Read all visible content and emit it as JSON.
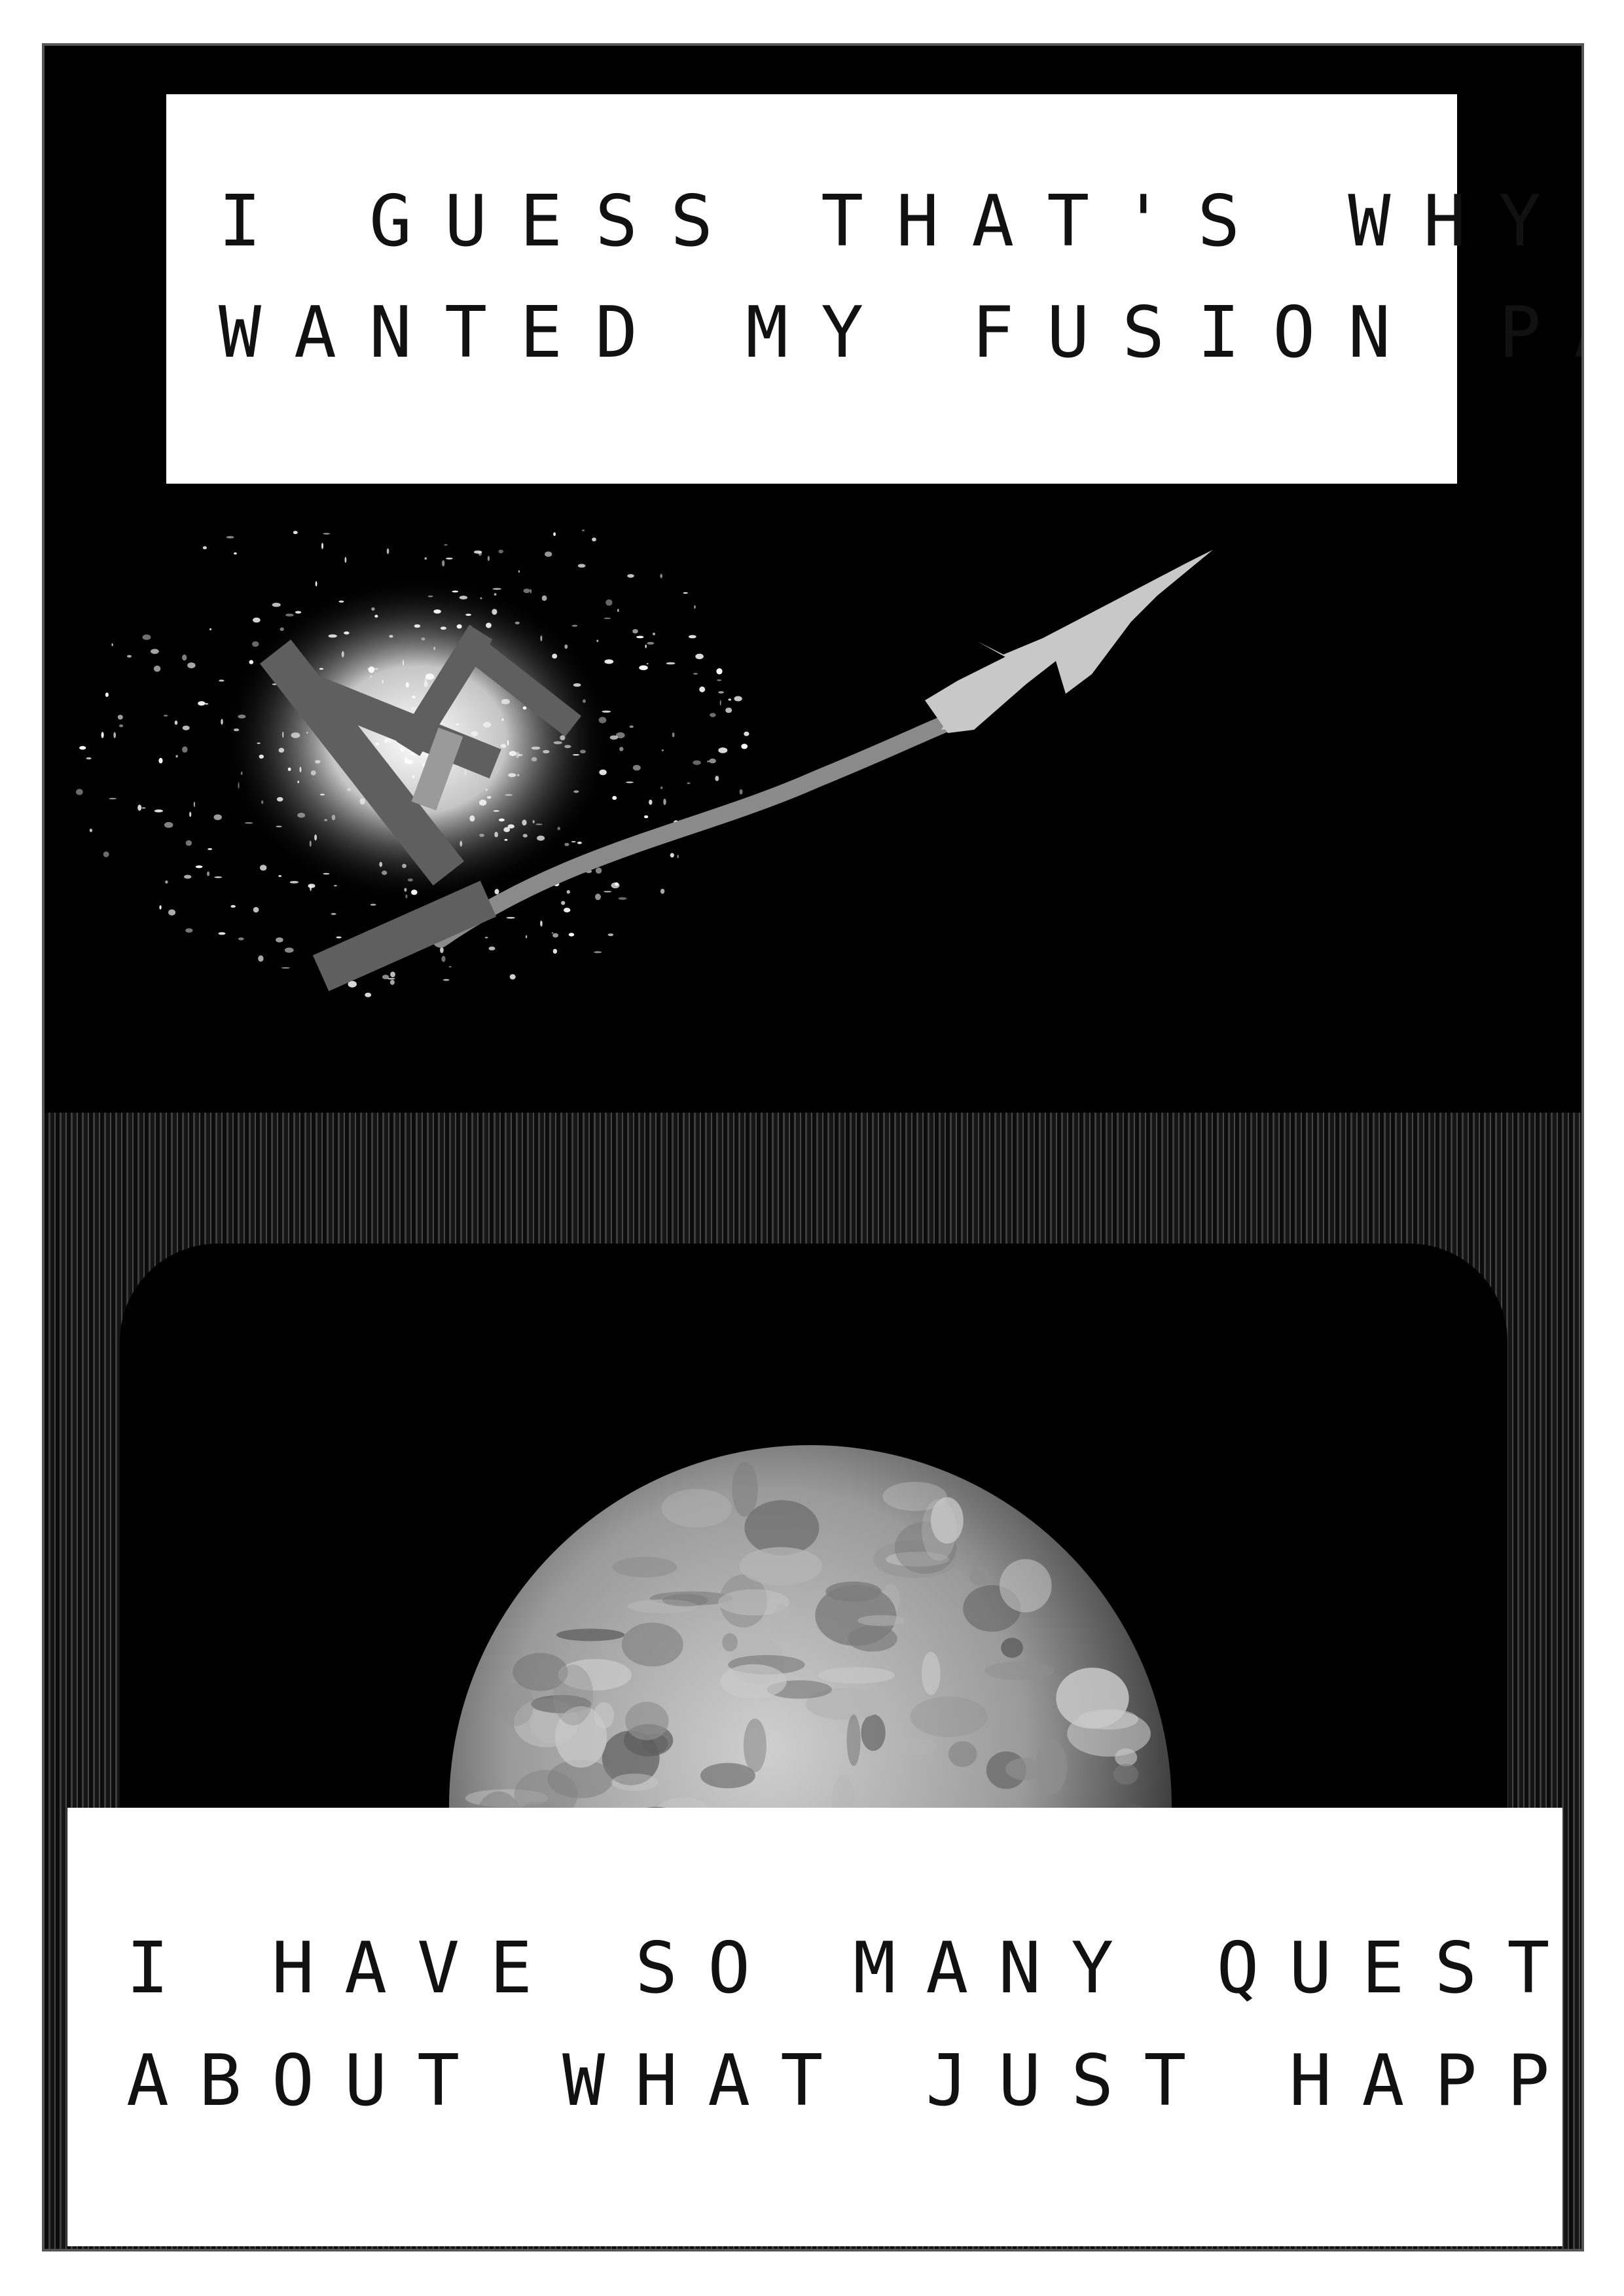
{
  "panels": {
    "top": {
      "caption_lines": [
        "I guess that's why he",
        "wanted my fusion pack.."
      ]
    },
    "bottom": {
      "caption_lines": [
        "I have so many questions",
        "about what just happened.."
      ]
    }
  },
  "colors": {
    "background": "#000000",
    "caption_box": "#ffffff",
    "station": "#6a6a6a",
    "ship": "#c8c8c8",
    "trail": "#8a8a8a",
    "moon_light": "#d9d9d9",
    "moon_dark": "#5a5a5a"
  },
  "icons": {
    "station": "space-station-icon",
    "ship": "spaceship-icon",
    "moon": "moon-icon"
  }
}
